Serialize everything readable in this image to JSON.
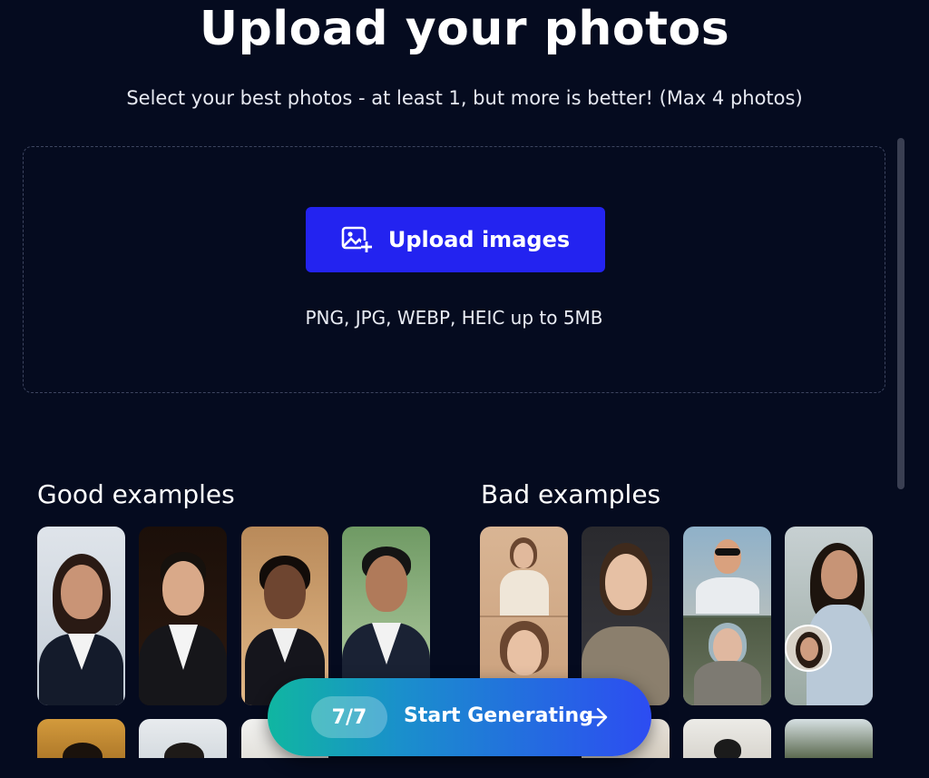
{
  "header": {
    "title": "Upload your photos",
    "subtitle": "Select your best photos - at least 1, but more is better! (Max 4 photos)"
  },
  "dropzone": {
    "button_label": "Upload images",
    "button_icon": "image-plus-icon",
    "formats_note": "PNG, JPG, WEBP, HEIC up to 5MB"
  },
  "examples": {
    "good_title": "Good examples",
    "bad_title": "Bad examples"
  },
  "cta": {
    "counter": "7/7",
    "label": "Start Generating",
    "icon": "arrow-right-icon"
  },
  "colors": {
    "background": "#050b1f",
    "primary_button": "#2323f0",
    "cta_gradient_start": "#10b6a1",
    "cta_gradient_end": "#2d4cf2"
  }
}
